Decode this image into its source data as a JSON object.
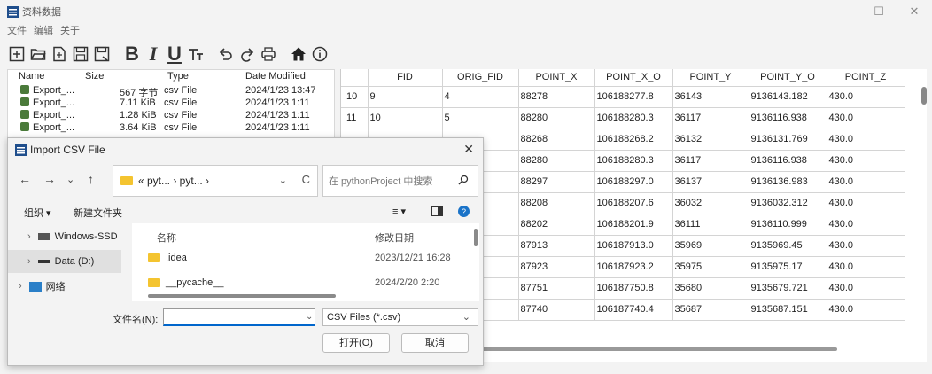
{
  "app": {
    "title": "资料数据"
  },
  "window_controls": {
    "minimize": "—",
    "maximize": "☐",
    "close": "✕"
  },
  "menu": [
    "文件",
    "编辑",
    "关于"
  ],
  "toolbar": {
    "new_glyph": "⊞",
    "open_glyph": "🗁",
    "b": "B",
    "i": "I",
    "u": "U",
    "t": "T",
    "undo": "↶",
    "redo": "↷",
    "home": "⌂",
    "info": "ⓘ"
  },
  "file_panel": {
    "headers": {
      "name": "Name",
      "size": "Size",
      "type": "Type",
      "date": "Date Modified"
    },
    "rows": [
      {
        "name": "Export_...",
        "size": "567 字节",
        "type": "csv File",
        "date": "2024/1/23 13:47"
      },
      {
        "name": "Export_...",
        "size": "7.11 KiB",
        "type": "csv File",
        "date": "2024/1/23 1:11"
      },
      {
        "name": "Export_...",
        "size": "1.28 KiB",
        "type": "csv File",
        "date": "2024/1/23 1:11"
      },
      {
        "name": "Export_...",
        "size": "3.64 KiB",
        "type": "csv File",
        "date": "2024/1/23 1:11"
      }
    ]
  },
  "table": {
    "columns": [
      "FID",
      "ORIG_FID",
      "POINT_X",
      "POINT_X_O",
      "POINT_Y",
      "POINT_Y_O",
      "POINT_Z"
    ],
    "rows": [
      {
        "rn": "10",
        "cells": [
          "9",
          "4",
          "88278",
          "106188277.8",
          "36143",
          "9136143.182",
          "430.0"
        ]
      },
      {
        "rn": "11",
        "cells": [
          "10",
          "5",
          "88280",
          "106188280.3",
          "36117",
          "9136116.938",
          "430.0"
        ]
      },
      {
        "rn": "",
        "cells": [
          "",
          "",
          "88268",
          "106188268.2",
          "36132",
          "9136131.769",
          "430.0"
        ]
      },
      {
        "rn": "",
        "cells": [
          "",
          "",
          "88280",
          "106188280.3",
          "36117",
          "9136116.938",
          "430.0"
        ]
      },
      {
        "rn": "",
        "cells": [
          "",
          "",
          "88297",
          "106188297.0",
          "36137",
          "9136136.983",
          "430.0"
        ]
      },
      {
        "rn": "",
        "cells": [
          "",
          "",
          "88208",
          "106188207.6",
          "36032",
          "9136032.312",
          "430.0"
        ]
      },
      {
        "rn": "",
        "cells": [
          "",
          "",
          "88202",
          "106188201.9",
          "36111",
          "9136110.999",
          "430.0"
        ]
      },
      {
        "rn": "",
        "cells": [
          "",
          "",
          "87913",
          "106187913.0",
          "35969",
          "9135969.45",
          "430.0"
        ]
      },
      {
        "rn": "",
        "cells": [
          "",
          "",
          "87923",
          "106187923.2",
          "35975",
          "9135975.17",
          "430.0"
        ]
      },
      {
        "rn": "",
        "cells": [
          "",
          "",
          "87751",
          "106187750.8",
          "35680",
          "9135679.721",
          "430.0"
        ]
      },
      {
        "rn": "",
        "cells": [
          "",
          "",
          "87740",
          "106187740.4",
          "35687",
          "9135687.151",
          "430.0"
        ]
      }
    ]
  },
  "dialog": {
    "title": "Import CSV File",
    "close": "✕",
    "nav": {
      "back": "←",
      "forward": "→",
      "recent": "⌄",
      "up": "↑"
    },
    "address": "« pyt... › pyt... ›",
    "address_drop": "⌄",
    "refresh": "C",
    "search_placeholder": "在 pythonProject 中搜索",
    "commands": {
      "organize": "组织 ▾",
      "new_folder": "新建文件夹",
      "view": "≡ ▾"
    },
    "nav_items": [
      {
        "label": "Windows-SSD"
      },
      {
        "label": "Data (D:)"
      },
      {
        "label": "网络"
      }
    ],
    "list_headers": {
      "name": "名称",
      "date": "修改日期"
    },
    "files": [
      {
        "name": ".idea",
        "date": "2023/12/21 16:28"
      },
      {
        "name": "__pycache__",
        "date": "2024/2/20 2:20"
      }
    ],
    "filename_label": "文件名(N):",
    "filename_value": "",
    "filetype": "CSV Files (*.csv)",
    "open_button": "打开(O)",
    "cancel_button": "取消"
  }
}
